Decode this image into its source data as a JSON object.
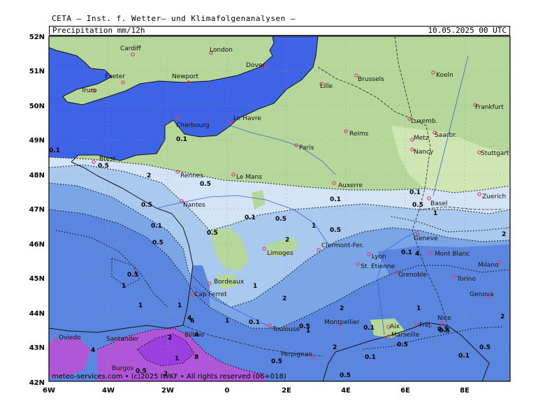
{
  "header": {
    "model": "CETA — Inst. f. Wetter— und Klimafolgenanalysen —",
    "param": "Precipitation  mm/12h",
    "valid_time": "10.05.2025 00 UTC"
  },
  "footer": {
    "credit": "meteo-services.com • (c)2025 IWKF • All rights reserved (06+018)"
  },
  "axes": {
    "lon_labels": [
      "6W",
      "4W",
      "2W",
      "0",
      "2E",
      "4E",
      "6E",
      "8E"
    ],
    "lat_labels": [
      "52N",
      "51N",
      "50N",
      "49N",
      "48N",
      "47N",
      "46N",
      "45N",
      "44N",
      "43N",
      "42N"
    ]
  },
  "colors": {
    "sea": "#3f63e6",
    "land": "#b5d89a",
    "land_light": "#cde6b4",
    "precip_01": "#d4e4f7",
    "precip_05": "#a9c9ee",
    "precip_1": "#7aa6e8",
    "precip_2": "#5b86e0",
    "precip_4": "#b056d8",
    "precip_6": "#9c3fe0",
    "city": "#e0406a",
    "mont_blanc": "#13b31e"
  },
  "cities": [
    "Cardiff",
    "London",
    "Dover",
    "Exeter",
    "Newport",
    "Truro",
    "Lille",
    "Brussels",
    "Koeln",
    "Frankfurt",
    "Cherbourg",
    "Le Havre",
    "Reims",
    "Luxemb.",
    "Saarbr.",
    "Metz",
    "Paris",
    "Nancy",
    "Stuttgart",
    "Brest",
    "Rennes",
    "Le Mans",
    "Auxerre",
    "Zuerich",
    "Nantes",
    "Basel",
    "Geneve",
    "Clermont-Fer.",
    "Lyon",
    "Limoges",
    "Mont Blanc",
    "St. Etienne",
    "Grenoble",
    "Milano",
    "Bordeaux",
    "Torino",
    "Cap Ferret",
    "Genova",
    "Montpellier",
    "Nice",
    "Toulouse",
    "Aix",
    "Frej.",
    "Marseille",
    "Oviedo",
    "Santander",
    "Bilbao",
    "Perpignan",
    "Burgos"
  ],
  "contour_labels": [
    "0.1",
    "0.1",
    "0.5",
    "0.5",
    "0.5",
    "2",
    "0.1",
    "0.5",
    "0.5",
    "0.1",
    "0.5",
    "1",
    "0.5",
    "2",
    "0.1",
    "0.1",
    "0.5",
    "1",
    "2",
    "0.5",
    "4",
    "1",
    "1",
    "2",
    "0.1",
    "0.5",
    "0.5",
    "2",
    "0.1",
    "0.5",
    "1",
    "0.5",
    "2",
    "1",
    "4",
    "2",
    "4",
    "6",
    "8",
    "1",
    "2",
    "4",
    "1",
    "1",
    "0.5",
    "0.1",
    "0.5",
    "0.1",
    "0.5",
    "2",
    "1",
    "0.5",
    "0.1"
  ]
}
